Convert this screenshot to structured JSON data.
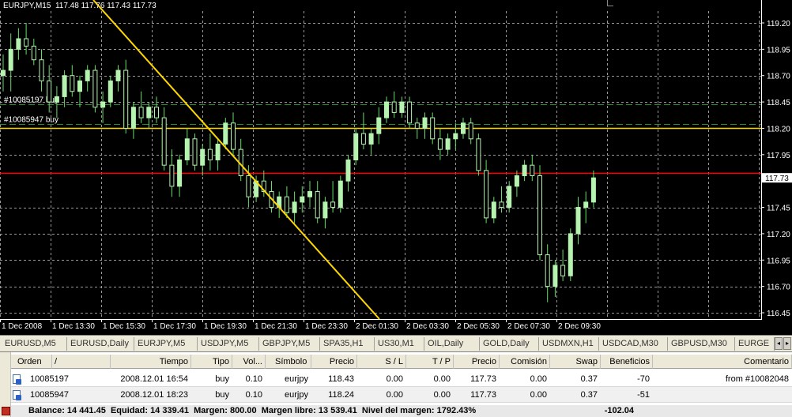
{
  "chart": {
    "title": "EURJPY,M15  117.48 117.76 117.43 117.73",
    "price_labels": [
      "119.20",
      "118.95",
      "118.70",
      "118.45",
      "118.20",
      "117.95",
      "117.73",
      "117.45",
      "117.20",
      "116.95",
      "116.70",
      "116.45"
    ],
    "price_values": [
      119.2,
      118.95,
      118.7,
      118.45,
      118.2,
      117.95,
      117.73,
      117.45,
      117.2,
      116.95,
      116.7,
      116.45
    ],
    "current_price": "117.73",
    "time_labels": [
      "1 Dec 2008",
      "1 Dec 13:30",
      "1 Dec 15:30",
      "1 Dec 17:30",
      "1 Dec 19:30",
      "1 Dec 21:30",
      "1 Dec 23:30",
      "2 Dec 01:30",
      "2 Dec 03:30",
      "2 Dec 05:30",
      "2 Dec 07:30",
      "2 Dec 09:30"
    ],
    "order_lines": [
      {
        "label": "#10085197 buy",
        "price": 118.43
      },
      {
        "label": "#10085947 buy",
        "price": 118.24
      }
    ],
    "horizontal_lines": [
      {
        "price": 118.2,
        "color": "#ffd700"
      },
      {
        "price": 117.78,
        "color": "#ff0000"
      }
    ],
    "colors": {
      "background": "#000000",
      "grid": "#9a9a9a",
      "candle": "#b6f2b0",
      "wick": "#66dd66",
      "order_line": "#2e8b2e",
      "trendline": "#ffd700"
    }
  },
  "chart_data": {
    "type": "candlestick",
    "title": "EURJPY,M15",
    "ylim": [
      116.4,
      119.3
    ],
    "ohlc": [
      [
        118.7,
        118.9,
        118.55,
        118.75
      ],
      [
        118.75,
        119.1,
        118.55,
        118.95
      ],
      [
        118.95,
        119.15,
        118.85,
        119.05
      ],
      [
        119.05,
        119.2,
        118.9,
        118.98
      ],
      [
        118.98,
        119.05,
        118.8,
        118.85
      ],
      [
        118.85,
        118.95,
        118.55,
        118.65
      ],
      [
        118.65,
        118.8,
        118.35,
        118.45
      ],
      [
        118.45,
        118.6,
        118.3,
        118.5
      ],
      [
        118.5,
        118.75,
        118.4,
        118.7
      ],
      [
        118.7,
        118.8,
        118.5,
        118.55
      ],
      [
        118.55,
        118.7,
        118.4,
        118.65
      ],
      [
        118.65,
        118.8,
        118.55,
        118.75
      ],
      [
        118.75,
        118.8,
        118.35,
        118.4
      ],
      [
        118.4,
        118.55,
        118.25,
        118.45
      ],
      [
        118.45,
        118.7,
        118.4,
        118.65
      ],
      [
        118.65,
        118.8,
        118.55,
        118.75
      ],
      [
        118.75,
        118.85,
        118.15,
        118.2
      ],
      [
        118.2,
        118.45,
        118.1,
        118.4
      ],
      [
        118.4,
        118.55,
        118.25,
        118.3
      ],
      [
        118.3,
        118.45,
        118.2,
        118.4
      ],
      [
        118.4,
        118.5,
        118.25,
        118.3
      ],
      [
        118.3,
        118.4,
        117.8,
        117.85
      ],
      [
        117.85,
        118.0,
        117.55,
        117.65
      ],
      [
        117.65,
        117.95,
        117.55,
        117.9
      ],
      [
        117.9,
        118.2,
        117.85,
        118.1
      ],
      [
        118.1,
        118.15,
        117.8,
        117.85
      ],
      [
        117.85,
        118.05,
        117.75,
        118.0
      ],
      [
        118.0,
        118.15,
        117.8,
        117.9
      ],
      [
        117.9,
        118.1,
        117.8,
        118.05
      ],
      [
        118.05,
        118.3,
        118.0,
        118.25
      ],
      [
        118.25,
        118.35,
        117.95,
        118.0
      ],
      [
        118.0,
        118.1,
        117.7,
        117.75
      ],
      [
        117.75,
        117.85,
        117.45,
        117.55
      ],
      [
        117.55,
        117.75,
        117.5,
        117.7
      ],
      [
        117.7,
        117.8,
        117.55,
        117.6
      ],
      [
        117.6,
        117.7,
        117.4,
        117.45
      ],
      [
        117.45,
        117.6,
        117.35,
        117.55
      ],
      [
        117.55,
        117.65,
        117.35,
        117.4
      ],
      [
        117.4,
        117.6,
        117.3,
        117.5
      ],
      [
        117.5,
        117.65,
        117.4,
        117.55
      ],
      [
        117.55,
        117.7,
        117.45,
        117.6
      ],
      [
        117.6,
        117.7,
        117.3,
        117.35
      ],
      [
        117.35,
        117.55,
        117.25,
        117.5
      ],
      [
        117.5,
        117.7,
        117.4,
        117.45
      ],
      [
        117.45,
        117.75,
        117.4,
        117.7
      ],
      [
        117.7,
        117.95,
        117.6,
        117.9
      ],
      [
        117.9,
        118.2,
        117.85,
        118.15
      ],
      [
        118.15,
        118.35,
        118.0,
        118.05
      ],
      [
        118.05,
        118.2,
        117.95,
        118.15
      ],
      [
        118.15,
        118.4,
        118.05,
        118.3
      ],
      [
        118.3,
        118.5,
        118.25,
        118.45
      ],
      [
        118.45,
        118.55,
        118.3,
        118.35
      ],
      [
        118.35,
        118.5,
        118.3,
        118.45
      ],
      [
        118.45,
        118.5,
        118.2,
        118.25
      ],
      [
        118.25,
        118.3,
        118.1,
        118.2
      ],
      [
        118.2,
        118.35,
        118.1,
        118.3
      ],
      [
        118.3,
        118.35,
        118.05,
        118.1
      ],
      [
        118.1,
        118.2,
        117.9,
        118.0
      ],
      [
        118.0,
        118.15,
        117.95,
        118.1
      ],
      [
        118.1,
        118.25,
        118.0,
        118.15
      ],
      [
        118.15,
        118.3,
        118.1,
        118.25
      ],
      [
        118.25,
        118.3,
        118.05,
        118.1
      ],
      [
        118.1,
        118.15,
        117.75,
        117.8
      ],
      [
        117.8,
        117.9,
        117.3,
        117.35
      ],
      [
        117.35,
        117.55,
        117.3,
        117.5
      ],
      [
        117.5,
        117.65,
        117.4,
        117.45
      ],
      [
        117.45,
        117.7,
        117.4,
        117.65
      ],
      [
        117.65,
        117.8,
        117.55,
        117.75
      ],
      [
        117.75,
        117.9,
        117.7,
        117.85
      ],
      [
        117.85,
        117.95,
        117.7,
        117.75
      ],
      [
        117.75,
        117.85,
        116.95,
        117.0
      ],
      [
        117.0,
        117.1,
        116.55,
        116.7
      ],
      [
        116.7,
        116.95,
        116.6,
        116.9
      ],
      [
        116.9,
        117.05,
        116.75,
        116.8
      ],
      [
        116.8,
        117.25,
        116.75,
        117.2
      ],
      [
        117.2,
        117.55,
        117.1,
        117.45
      ],
      [
        117.45,
        117.6,
        117.3,
        117.5
      ],
      [
        117.5,
        117.8,
        117.45,
        117.73
      ]
    ]
  },
  "tabs": [
    "EURUSD,M5",
    "EURUSD,Daily",
    "EURJPY,M5",
    "USDJPY,M5",
    "GBPJPY,M5",
    "SPA35,H1",
    "US30,M1",
    "OIL,Daily",
    "GOLD,Daily",
    "USDMXN,H1",
    "USDCAD,M30",
    "GBPUSD,M30",
    "EURGE"
  ],
  "terminal": {
    "headers": [
      "Orden",
      "/",
      "Tiempo",
      "Tipo",
      "Vol...",
      "Símbolo",
      "Precio",
      "S / L",
      "T / P",
      "Precio",
      "Comisión",
      "Swap",
      "Beneficios",
      "Comentario"
    ],
    "rows": [
      {
        "orden": "10085197",
        "tiempo": "2008.12.01 16:54",
        "tipo": "buy",
        "vol": "0.10",
        "simbolo": "eurjpy",
        "precio": "118.43",
        "sl": "0.00",
        "tp": "0.00",
        "precio2": "117.73",
        "comision": "0.00",
        "swap": "0.37",
        "beneficios": "-70",
        "comentario": "from #10082048"
      },
      {
        "orden": "10085947",
        "tiempo": "2008.12.01 18:23",
        "tipo": "buy",
        "vol": "0.10",
        "simbolo": "eurjpy",
        "precio": "118.24",
        "sl": "0.00",
        "tp": "0.00",
        "precio2": "117.73",
        "comision": "0.00",
        "swap": "0.37",
        "beneficios": "-51",
        "comentario": ""
      }
    ],
    "balance_text": "Balance: 14 441.45  Equidad: 14 339.41  Margen: 800.00  Margen libre: 13 539.41  Nivel del margen: 1792.43%",
    "total_profit": "-102.04"
  }
}
